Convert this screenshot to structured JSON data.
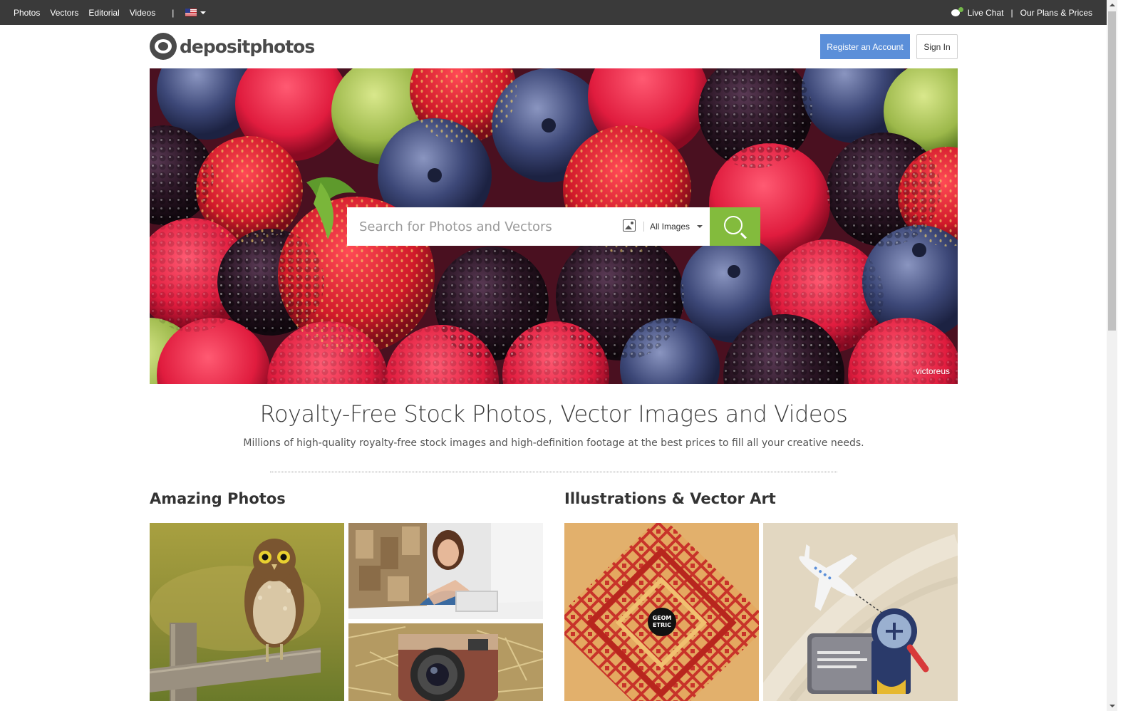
{
  "topbar": {
    "nav": [
      "Photos",
      "Vectors",
      "Editorial",
      "Videos"
    ],
    "separator": "|",
    "live_chat": "Live Chat",
    "divider": "|",
    "plans": "Our Plans & Prices"
  },
  "header": {
    "logo_text": "depositphotos",
    "register_label": "Register an Account",
    "signin_label": "Sign In"
  },
  "hero": {
    "search_placeholder": "Search for Photos and Vectors",
    "type_selected": "All Images",
    "credit": "victoreus"
  },
  "intro": {
    "headline": "Royalty-Free Stock Photos, Vector Images and Videos",
    "subline": "Millions of high-quality royalty-free stock images and high-definition footage at the best prices to fill all your creative needs."
  },
  "sections": {
    "photos_title": "Amazing Photos",
    "vectors_title": "Illustrations & Vector Art",
    "badge_text_1": "GEOM",
    "badge_text_2": "ETRIC"
  }
}
